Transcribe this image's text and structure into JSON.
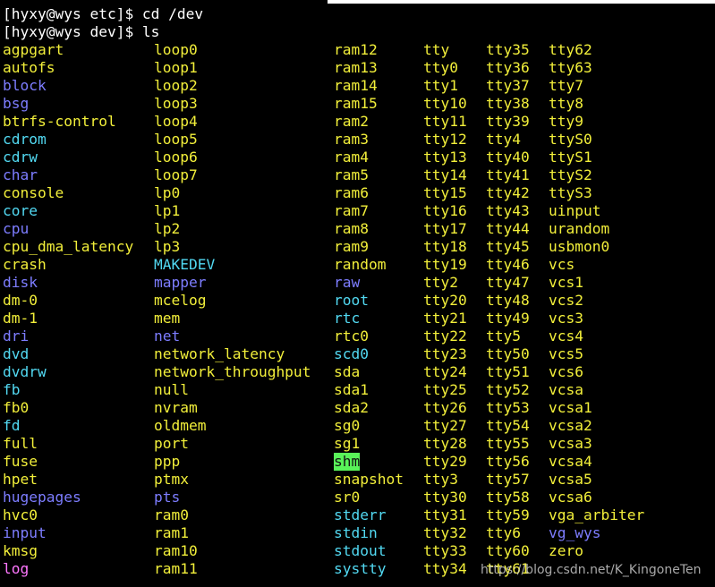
{
  "colors": {
    "background": "#000000",
    "default": "#ffffff",
    "dir": "#7d7dff",
    "link": "#52d9f2",
    "dev": "#f2ef3a",
    "exec": "#59f259",
    "sticky_bg": "#59f259",
    "sticky_fg": "#111111"
  },
  "prompt_lines": [
    "[hyxy@wys etc]$ cd /dev",
    "[hyxy@wys dev]$ ls"
  ],
  "listing": {
    "columns": [
      [
        {
          "text": "agpgart",
          "type": "dev"
        },
        {
          "text": "autofs",
          "type": "dev"
        },
        {
          "text": "block",
          "type": "dir"
        },
        {
          "text": "bsg",
          "type": "dir"
        },
        {
          "text": "btrfs-control",
          "type": "dev"
        },
        {
          "text": "cdrom",
          "type": "link"
        },
        {
          "text": "cdrw",
          "type": "link"
        },
        {
          "text": "char",
          "type": "dir"
        },
        {
          "text": "console",
          "type": "dev"
        },
        {
          "text": "core",
          "type": "link"
        },
        {
          "text": "cpu",
          "type": "dir"
        },
        {
          "text": "cpu_dma_latency",
          "type": "dev"
        },
        {
          "text": "crash",
          "type": "dev"
        },
        {
          "text": "disk",
          "type": "dir"
        },
        {
          "text": "dm-0",
          "type": "dev"
        },
        {
          "text": "dm-1",
          "type": "dev"
        },
        {
          "text": "dri",
          "type": "dir"
        },
        {
          "text": "dvd",
          "type": "link"
        },
        {
          "text": "dvdrw",
          "type": "link"
        },
        {
          "text": "fb",
          "type": "link"
        },
        {
          "text": "fb0",
          "type": "dev"
        },
        {
          "text": "fd",
          "type": "link"
        },
        {
          "text": "full",
          "type": "dev"
        },
        {
          "text": "fuse",
          "type": "dev"
        },
        {
          "text": "hpet",
          "type": "dev"
        },
        {
          "text": "hugepages",
          "type": "dir"
        },
        {
          "text": "hvc0",
          "type": "dev"
        },
        {
          "text": "input",
          "type": "dir"
        },
        {
          "text": "kmsg",
          "type": "dev"
        },
        {
          "text": "log",
          "type": "socket"
        }
      ],
      [
        {
          "text": "loop0",
          "type": "dev"
        },
        {
          "text": "loop1",
          "type": "dev"
        },
        {
          "text": "loop2",
          "type": "dev"
        },
        {
          "text": "loop3",
          "type": "dev"
        },
        {
          "text": "loop4",
          "type": "dev"
        },
        {
          "text": "loop5",
          "type": "dev"
        },
        {
          "text": "loop6",
          "type": "dev"
        },
        {
          "text": "loop7",
          "type": "dev"
        },
        {
          "text": "lp0",
          "type": "dev"
        },
        {
          "text": "lp1",
          "type": "dev"
        },
        {
          "text": "lp2",
          "type": "dev"
        },
        {
          "text": "lp3",
          "type": "dev"
        },
        {
          "text": "MAKEDEV",
          "type": "link"
        },
        {
          "text": "mapper",
          "type": "dir"
        },
        {
          "text": "mcelog",
          "type": "dev"
        },
        {
          "text": "mem",
          "type": "dev"
        },
        {
          "text": "net",
          "type": "dir"
        },
        {
          "text": "network_latency",
          "type": "dev"
        },
        {
          "text": "network_throughput",
          "type": "dev"
        },
        {
          "text": "null",
          "type": "dev"
        },
        {
          "text": "nvram",
          "type": "dev"
        },
        {
          "text": "oldmem",
          "type": "dev"
        },
        {
          "text": "port",
          "type": "dev"
        },
        {
          "text": "ppp",
          "type": "dev"
        },
        {
          "text": "ptmx",
          "type": "dev"
        },
        {
          "text": "pts",
          "type": "dir"
        },
        {
          "text": "ram0",
          "type": "dev"
        },
        {
          "text": "ram1",
          "type": "dev"
        },
        {
          "text": "ram10",
          "type": "dev"
        },
        {
          "text": "ram11",
          "type": "dev"
        }
      ],
      [
        {
          "text": "ram12",
          "type": "dev"
        },
        {
          "text": "ram13",
          "type": "dev"
        },
        {
          "text": "ram14",
          "type": "dev"
        },
        {
          "text": "ram15",
          "type": "dev"
        },
        {
          "text": "ram2",
          "type": "dev"
        },
        {
          "text": "ram3",
          "type": "dev"
        },
        {
          "text": "ram4",
          "type": "dev"
        },
        {
          "text": "ram5",
          "type": "dev"
        },
        {
          "text": "ram6",
          "type": "dev"
        },
        {
          "text": "ram7",
          "type": "dev"
        },
        {
          "text": "ram8",
          "type": "dev"
        },
        {
          "text": "ram9",
          "type": "dev"
        },
        {
          "text": "random",
          "type": "dev"
        },
        {
          "text": "raw",
          "type": "dir"
        },
        {
          "text": "root",
          "type": "link"
        },
        {
          "text": "rtc",
          "type": "link"
        },
        {
          "text": "rtc0",
          "type": "dev"
        },
        {
          "text": "scd0",
          "type": "link"
        },
        {
          "text": "sda",
          "type": "dev"
        },
        {
          "text": "sda1",
          "type": "dev"
        },
        {
          "text": "sda2",
          "type": "dev"
        },
        {
          "text": "sg0",
          "type": "dev"
        },
        {
          "text": "sg1",
          "type": "dev"
        },
        {
          "text": "shm",
          "type": "sticky"
        },
        {
          "text": "snapshot",
          "type": "dev"
        },
        {
          "text": "sr0",
          "type": "dev"
        },
        {
          "text": "stderr",
          "type": "link"
        },
        {
          "text": "stdin",
          "type": "link"
        },
        {
          "text": "stdout",
          "type": "link"
        },
        {
          "text": "systty",
          "type": "link"
        }
      ],
      [
        {
          "text": "tty",
          "type": "dev"
        },
        {
          "text": "tty0",
          "type": "dev"
        },
        {
          "text": "tty1",
          "type": "dev"
        },
        {
          "text": "tty10",
          "type": "dev"
        },
        {
          "text": "tty11",
          "type": "dev"
        },
        {
          "text": "tty12",
          "type": "dev"
        },
        {
          "text": "tty13",
          "type": "dev"
        },
        {
          "text": "tty14",
          "type": "dev"
        },
        {
          "text": "tty15",
          "type": "dev"
        },
        {
          "text": "tty16",
          "type": "dev"
        },
        {
          "text": "tty17",
          "type": "dev"
        },
        {
          "text": "tty18",
          "type": "dev"
        },
        {
          "text": "tty19",
          "type": "dev"
        },
        {
          "text": "tty2",
          "type": "dev"
        },
        {
          "text": "tty20",
          "type": "dev"
        },
        {
          "text": "tty21",
          "type": "dev"
        },
        {
          "text": "tty22",
          "type": "dev"
        },
        {
          "text": "tty23",
          "type": "dev"
        },
        {
          "text": "tty24",
          "type": "dev"
        },
        {
          "text": "tty25",
          "type": "dev"
        },
        {
          "text": "tty26",
          "type": "dev"
        },
        {
          "text": "tty27",
          "type": "dev"
        },
        {
          "text": "tty28",
          "type": "dev"
        },
        {
          "text": "tty29",
          "type": "dev"
        },
        {
          "text": "tty3",
          "type": "dev"
        },
        {
          "text": "tty30",
          "type": "dev"
        },
        {
          "text": "tty31",
          "type": "dev"
        },
        {
          "text": "tty32",
          "type": "dev"
        },
        {
          "text": "tty33",
          "type": "dev"
        },
        {
          "text": "tty34",
          "type": "dev"
        }
      ],
      [
        {
          "text": "tty35",
          "type": "dev"
        },
        {
          "text": "tty36",
          "type": "dev"
        },
        {
          "text": "tty37",
          "type": "dev"
        },
        {
          "text": "tty38",
          "type": "dev"
        },
        {
          "text": "tty39",
          "type": "dev"
        },
        {
          "text": "tty4",
          "type": "dev"
        },
        {
          "text": "tty40",
          "type": "dev"
        },
        {
          "text": "tty41",
          "type": "dev"
        },
        {
          "text": "tty42",
          "type": "dev"
        },
        {
          "text": "tty43",
          "type": "dev"
        },
        {
          "text": "tty44",
          "type": "dev"
        },
        {
          "text": "tty45",
          "type": "dev"
        },
        {
          "text": "tty46",
          "type": "dev"
        },
        {
          "text": "tty47",
          "type": "dev"
        },
        {
          "text": "tty48",
          "type": "dev"
        },
        {
          "text": "tty49",
          "type": "dev"
        },
        {
          "text": "tty5",
          "type": "dev"
        },
        {
          "text": "tty50",
          "type": "dev"
        },
        {
          "text": "tty51",
          "type": "dev"
        },
        {
          "text": "tty52",
          "type": "dev"
        },
        {
          "text": "tty53",
          "type": "dev"
        },
        {
          "text": "tty54",
          "type": "dev"
        },
        {
          "text": "tty55",
          "type": "dev"
        },
        {
          "text": "tty56",
          "type": "dev"
        },
        {
          "text": "tty57",
          "type": "dev"
        },
        {
          "text": "tty58",
          "type": "dev"
        },
        {
          "text": "tty59",
          "type": "dev"
        },
        {
          "text": "tty6",
          "type": "dev"
        },
        {
          "text": "tty60",
          "type": "dev"
        },
        {
          "text": "tty61",
          "type": "dev"
        }
      ],
      [
        {
          "text": "tty62",
          "type": "dev"
        },
        {
          "text": "tty63",
          "type": "dev"
        },
        {
          "text": "tty7",
          "type": "dev"
        },
        {
          "text": "tty8",
          "type": "dev"
        },
        {
          "text": "tty9",
          "type": "dev"
        },
        {
          "text": "ttyS0",
          "type": "dev"
        },
        {
          "text": "ttyS1",
          "type": "dev"
        },
        {
          "text": "ttyS2",
          "type": "dev"
        },
        {
          "text": "ttyS3",
          "type": "dev"
        },
        {
          "text": "uinput",
          "type": "dev"
        },
        {
          "text": "urandom",
          "type": "dev"
        },
        {
          "text": "usbmon0",
          "type": "dev"
        },
        {
          "text": "vcs",
          "type": "dev"
        },
        {
          "text": "vcs1",
          "type": "dev"
        },
        {
          "text": "vcs2",
          "type": "dev"
        },
        {
          "text": "vcs3",
          "type": "dev"
        },
        {
          "text": "vcs4",
          "type": "dev"
        },
        {
          "text": "vcs5",
          "type": "dev"
        },
        {
          "text": "vcs6",
          "type": "dev"
        },
        {
          "text": "vcsa",
          "type": "dev"
        },
        {
          "text": "vcsa1",
          "type": "dev"
        },
        {
          "text": "vcsa2",
          "type": "dev"
        },
        {
          "text": "vcsa3",
          "type": "dev"
        },
        {
          "text": "vcsa4",
          "type": "dev"
        },
        {
          "text": "vcsa5",
          "type": "dev"
        },
        {
          "text": "vcsa6",
          "type": "dev"
        },
        {
          "text": "vga_arbiter",
          "type": "dev"
        },
        {
          "text": "vg_wys",
          "type": "dir"
        },
        {
          "text": "zero",
          "type": "dev"
        },
        {
          "text": ""
        }
      ]
    ]
  },
  "watermark": "https://blog.csdn.net/K_KingoneTen"
}
